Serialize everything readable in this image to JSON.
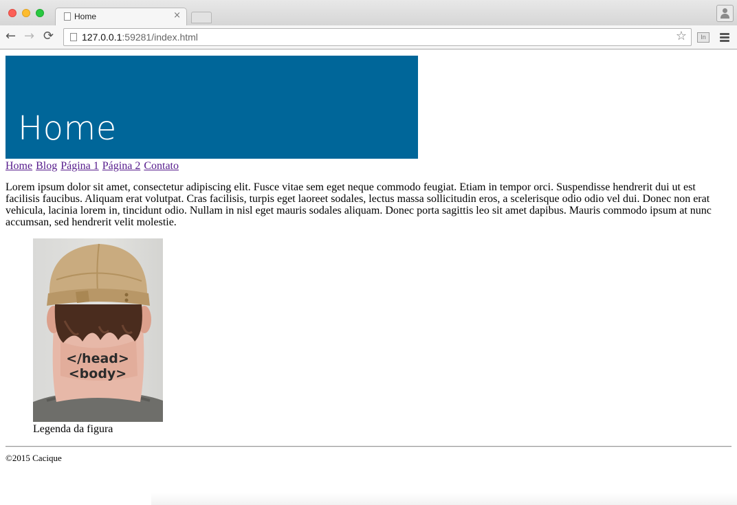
{
  "browser": {
    "tab_title": "Home",
    "tab_close": "×",
    "url_host": "127.0.0.1",
    "url_rest": ":59281/index.html",
    "extension_label": "In"
  },
  "page": {
    "banner_title": "Home",
    "banner_color": "#006699",
    "nav": [
      {
        "label": "Home"
      },
      {
        "label": "Blog"
      },
      {
        "label": "Página 1"
      },
      {
        "label": "Página 2"
      },
      {
        "label": "Contato"
      }
    ],
    "paragraph": "Lorem ipsum dolor sit amet, consectetur adipiscing elit. Fusce vitae sem eget neque commodo feugiat. Etiam in tempor orci. Suspendisse hendrerit dui ut est facilisis faucibus. Aliquam erat volutpat. Cras facilisis, turpis eget laoreet sodales, lectus massa sollicitudin eros, a scelerisque odio odio vel dui. Donec non erat vehicula, lacinia lorem in, tincidunt odio. Nullam in nisl eget mauris sodales aliquam. Donec porta sagittis leo sit amet dapibus. Mauris commodo ipsum at nunc accumsan, sed hendrerit velit molestie.",
    "figure": {
      "tattoo_line1": "</head>",
      "tattoo_line2": "<body>",
      "caption": "Legenda da figura"
    },
    "footer": "©2015 Cacique"
  }
}
